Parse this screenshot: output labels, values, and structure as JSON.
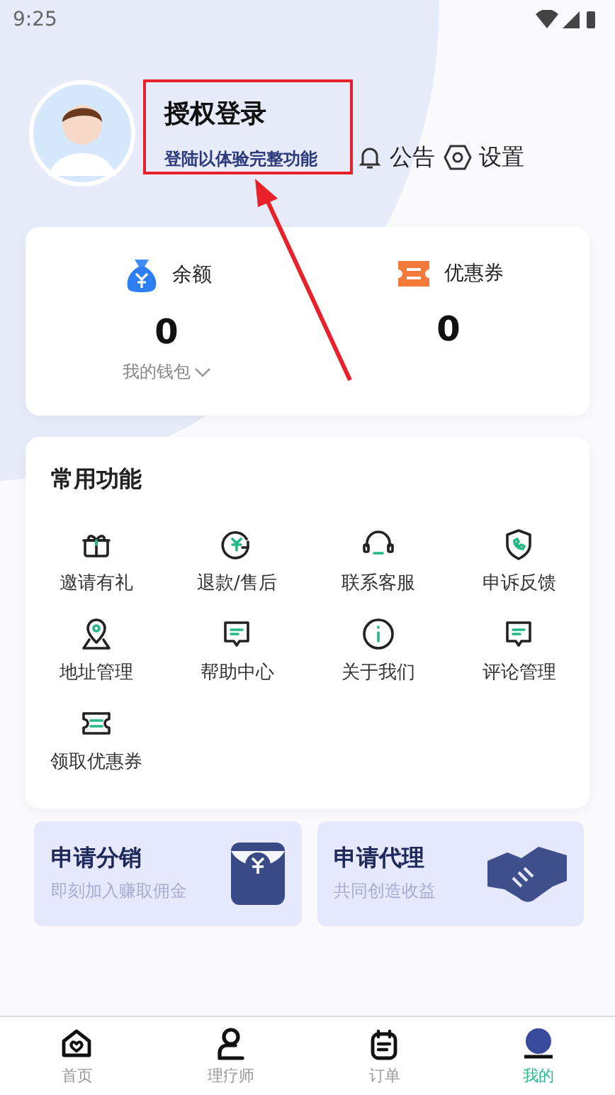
{
  "status_bar": {
    "time": "9:25"
  },
  "profile": {
    "title": "授权登录",
    "subtitle": "登陆以体验完整功能"
  },
  "header_actions": [
    {
      "label": "公告"
    },
    {
      "label": "设置"
    }
  ],
  "wallet": [
    {
      "label": "余额",
      "value": "0",
      "link": "我的钱包"
    },
    {
      "label": "优惠券",
      "value": "0"
    }
  ],
  "functions": {
    "title": "常用功能",
    "items": [
      {
        "label": "邀请有礼"
      },
      {
        "label": "退款/售后"
      },
      {
        "label": "联系客服"
      },
      {
        "label": "申诉反馈"
      },
      {
        "label": "地址管理"
      },
      {
        "label": "帮助中心"
      },
      {
        "label": "关于我们"
      },
      {
        "label": "评论管理"
      },
      {
        "label": "领取优惠券"
      }
    ]
  },
  "promos": [
    {
      "title": "申请分销",
      "subtitle": "即刻加入赚取佣金"
    },
    {
      "title": "申请代理",
      "subtitle": "共同创造收益"
    }
  ],
  "tab_bar": [
    {
      "label": "首页",
      "selected": false
    },
    {
      "label": "理疗师",
      "selected": false
    },
    {
      "label": "订单",
      "selected": false
    },
    {
      "label": "我的",
      "selected": true
    }
  ]
}
